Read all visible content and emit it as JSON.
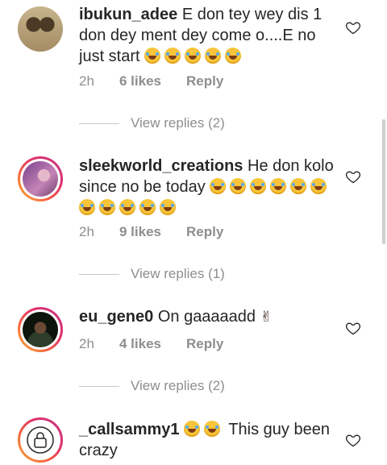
{
  "comments": [
    {
      "username": "ibukun_adee",
      "text": "E don tey wey dis 1 don dey ment dey come o....E no just start",
      "emoji_count": 5,
      "time": "2h",
      "likes": "6 likes",
      "reply": "Reply",
      "view_replies": "View replies (2)",
      "avatar_color": "#b9a27c",
      "story_ring": false
    },
    {
      "username": "sleekworld_creations",
      "text": "He don kolo since no be today",
      "emoji_count": 11,
      "time": "2h",
      "likes": "9 likes",
      "reply": "Reply",
      "view_replies": "View replies (1)",
      "avatar_color": "#9c6aa8",
      "story_ring": true
    },
    {
      "username": "eu_gene0",
      "text": "On gaaaaadd",
      "emoji_icon": "victory-hand-emoji",
      "time": "2h",
      "likes": "4 likes",
      "reply": "Reply",
      "view_replies": "View replies (2)",
      "avatar_color": "#1f2a1a",
      "story_ring": true
    },
    {
      "username": "_callsammy1",
      "text": "This guy been crazy",
      "emoji_count": 2,
      "avatar_icon": "lock-icon",
      "story_ring": true
    }
  ],
  "colors": {
    "text": "#262626",
    "secondary": "#8e8e8e",
    "ring_start": "#f9b233",
    "ring_end": "#c13584"
  },
  "icons": {
    "like": "heart-outline-icon",
    "laugh": "face-with-tears-of-joy-emoji"
  }
}
